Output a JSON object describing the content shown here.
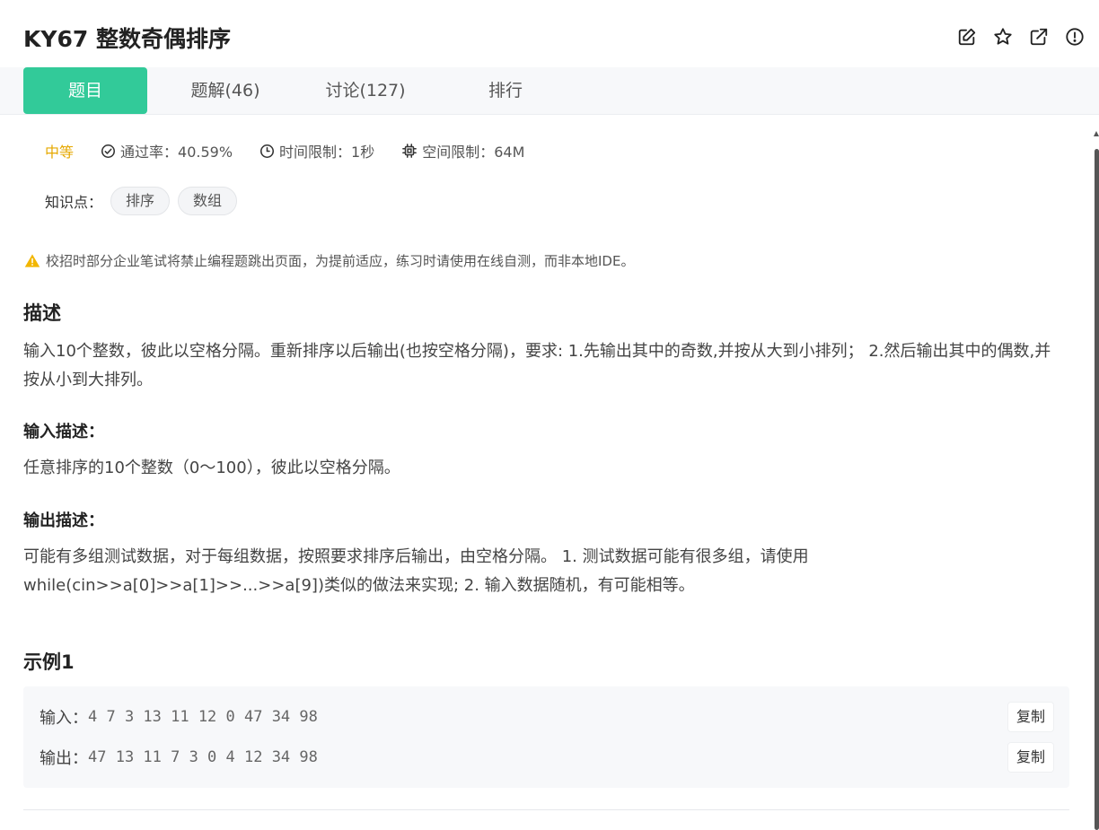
{
  "header": {
    "title": "KY67  整数奇偶排序"
  },
  "tabs": [
    {
      "label": "题目",
      "active": true
    },
    {
      "label": "题解(46)",
      "active": false
    },
    {
      "label": "讨论(127)",
      "active": false
    },
    {
      "label": "排行",
      "active": false
    }
  ],
  "meta": {
    "difficulty": "中等",
    "pass_rate": "通过率：40.59%",
    "time_limit": "时间限制：1秒",
    "space_limit": "空间限制：64M"
  },
  "knowledge": {
    "label": "知识点：",
    "tags": [
      "排序",
      "数组"
    ]
  },
  "notice": "校招时部分企业笔试将禁止编程题跳出页面，为提前适应，练习时请使用在线自测，而非本地IDE。",
  "description": {
    "heading": "描述",
    "text": "输入10个整数，彼此以空格分隔。重新排序以后输出(也按空格分隔)，要求: 1.先输出其中的奇数,并按从大到小排列； 2.然后输出其中的偶数,并按从小到大排列。"
  },
  "input_desc": {
    "heading": "输入描述：",
    "text": "任意排序的10个整数（0～100），彼此以空格分隔。"
  },
  "output_desc": {
    "heading": "输出描述：",
    "text": "可能有多组测试数据，对于每组数据，按照要求排序后输出，由空格分隔。 1. 测试数据可能有很多组，请使用while(cin>>a[0]>>a[1]>>...>>a[9])类似的做法来实现; 2. 输入数据随机，有可能相等。"
  },
  "example": {
    "heading": "示例1",
    "input_label": "输入：",
    "input_value": "4 7 3 13 11 12 0 47 34 98",
    "output_label": "输出：",
    "output_value": "47 13 11 7 3 0 4 12 34 98",
    "copy_label": "复制"
  },
  "colors": {
    "accent": "#32ca99",
    "difficulty": "#e6a800",
    "warning": "#f2b600"
  }
}
